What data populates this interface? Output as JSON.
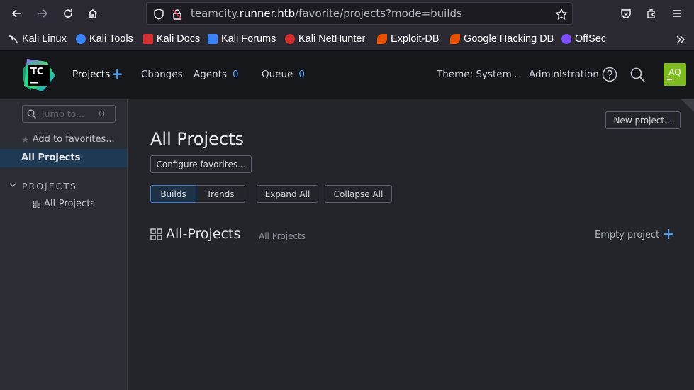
{
  "browser": {
    "url_prefix": "teamcity.",
    "url_host": "runner.htb",
    "url_path": "/favorite/projects?mode=builds"
  },
  "bookmarks": [
    {
      "label": "Kali Linux",
      "color": "#4a90d9"
    },
    {
      "label": "Kali Tools",
      "color": "#3b82f6"
    },
    {
      "label": "Kali Docs",
      "color": "#d32f2f"
    },
    {
      "label": "Kali Forums",
      "color": "#3b82f6"
    },
    {
      "label": "Kali NetHunter",
      "color": "#d32f2f"
    },
    {
      "label": "Exploit-DB",
      "color": "#e65100"
    },
    {
      "label": "Google Hacking DB",
      "color": "#e65100"
    },
    {
      "label": "OffSec",
      "color": "#7c4dff"
    }
  ],
  "header": {
    "logo_text": "TC",
    "projects": "Projects",
    "changes": "Changes",
    "agents": "Agents",
    "agents_count": "0",
    "queue": "Queue",
    "queue_count": "0",
    "theme": "Theme: System",
    "administration": "Administration",
    "avatar": "AQ",
    "accent": "#4ea2ff",
    "avatar_color": "#7ebc1f"
  },
  "sidebar": {
    "search_placeholder": "Jump to...",
    "search_shortcut": "Q",
    "add_favorites": "Add to favorites...",
    "all_projects": "All Projects",
    "projects_header": "PROJECTS",
    "all_projects_item": "All-Projects"
  },
  "main": {
    "new_project": "New project...",
    "title": "All Projects",
    "configure_favorites": "Configure favorites...",
    "tab_builds": "Builds",
    "tab_trends": "Trends",
    "expand_all": "Expand All",
    "collapse_all": "Collapse All",
    "section_title": "All-Projects",
    "section_sub": "All Projects",
    "empty_project": "Empty project"
  }
}
